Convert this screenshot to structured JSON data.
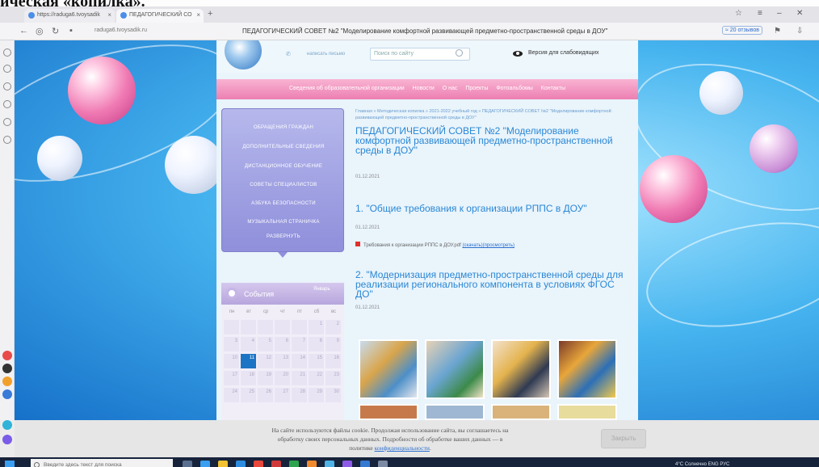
{
  "document": {
    "heading": "ическая «копилка»."
  },
  "browser": {
    "tabs": [
      {
        "label": "https://raduga6.tvoysadik"
      },
      {
        "label": "ПЕДАГОГИЧЕСКИЙ СО"
      }
    ],
    "address_url": "raduga6.tvoysadik.ru",
    "page_title": "ПЕДАГОГИЧЕСКИЙ СОВЕТ №2 \"Моделирование комфортной развивающей предметно-пространственной среды в ДОУ\"",
    "zoom_label": "≈ 20 отзывов"
  },
  "site": {
    "header_small": "написать письмо",
    "search_placeholder": "Поиск по сайту",
    "low_vision": "Версия для слабовидящих",
    "nav": [
      "Сведения об образовательной организации",
      "Новости",
      "О нас",
      "Проекты",
      "Фотоальбомы",
      "Контакты"
    ],
    "side_menu": [
      "ОБРАЩЕНИЯ ГРАЖДАН",
      "ДОПОЛНИТЕЛЬНЫЕ СВЕДЕНИЯ",
      "ДИСТАНЦИОННОЕ ОБУЧЕНИЕ",
      "СОВЕТЫ СПЕЦИАЛИСТОВ",
      "АЗБУКА БЕЗОПАСНОСТИ",
      "МУЗЫКАЛЬНАЯ СТРАНИЧКА",
      "РАЗВЕРНУТЬ"
    ],
    "calendar": {
      "title": "События",
      "month": "Январь",
      "weekdays": [
        "пн",
        "вт",
        "ср",
        "чт",
        "пт",
        "сб",
        "вс"
      ],
      "rows": [
        [
          "",
          "",
          "",
          "",
          "",
          "1",
          "2"
        ],
        [
          "3",
          "4",
          "5",
          "6",
          "7",
          "8",
          "9"
        ],
        [
          "10",
          "11",
          "12",
          "13",
          "14",
          "15",
          "16"
        ],
        [
          "17",
          "18",
          "19",
          "20",
          "21",
          "22",
          "23"
        ],
        [
          "24",
          "25",
          "26",
          "27",
          "28",
          "29",
          "30"
        ]
      ],
      "today": "11"
    },
    "breadcrumbs": "Главная » Методическая копилка » 2021-2022 учебный год » ПЕДАГОГИЧЕСКИЙ СОВЕТ №2 \"Моделирование комфортной развивающей предметно-пространственной среды в ДОУ\"",
    "page_heading": "ПЕДАГОГИЧЕСКИЙ СОВЕТ №2 \"Моделирование комфортной развивающей предметно-пространственной среды в ДОУ\"",
    "date1": "01.12.2021",
    "section1": "1. \"Общие требования к организации РППС в ДОУ\"",
    "date2": "01.12.2021",
    "file_name": "Требования к организации РППС в ДОУ.pdf",
    "file_download": "(скачать)",
    "file_view": "(просмотреть)",
    "section2": "2. \"Модернизация предметно-пространственной среды для реализации регионального компонента в условиях ФГОС ДО\"",
    "date3": "01.12.2021"
  },
  "cookie": {
    "line1": "На сайте используются файлы cookie. Продолжая использование сайта, вы соглашаетесь на",
    "line2": "обработку своих персональных данных. Подробности об обработке ваших данных — в",
    "line3_prefix": "политике",
    "line3_link": "конфиденциальности",
    "close": "Закрыть"
  },
  "taskbar": {
    "search_placeholder": "Введите здесь текст для поиска",
    "tray_text": "4°C Солнечно  ENG  РУС"
  }
}
